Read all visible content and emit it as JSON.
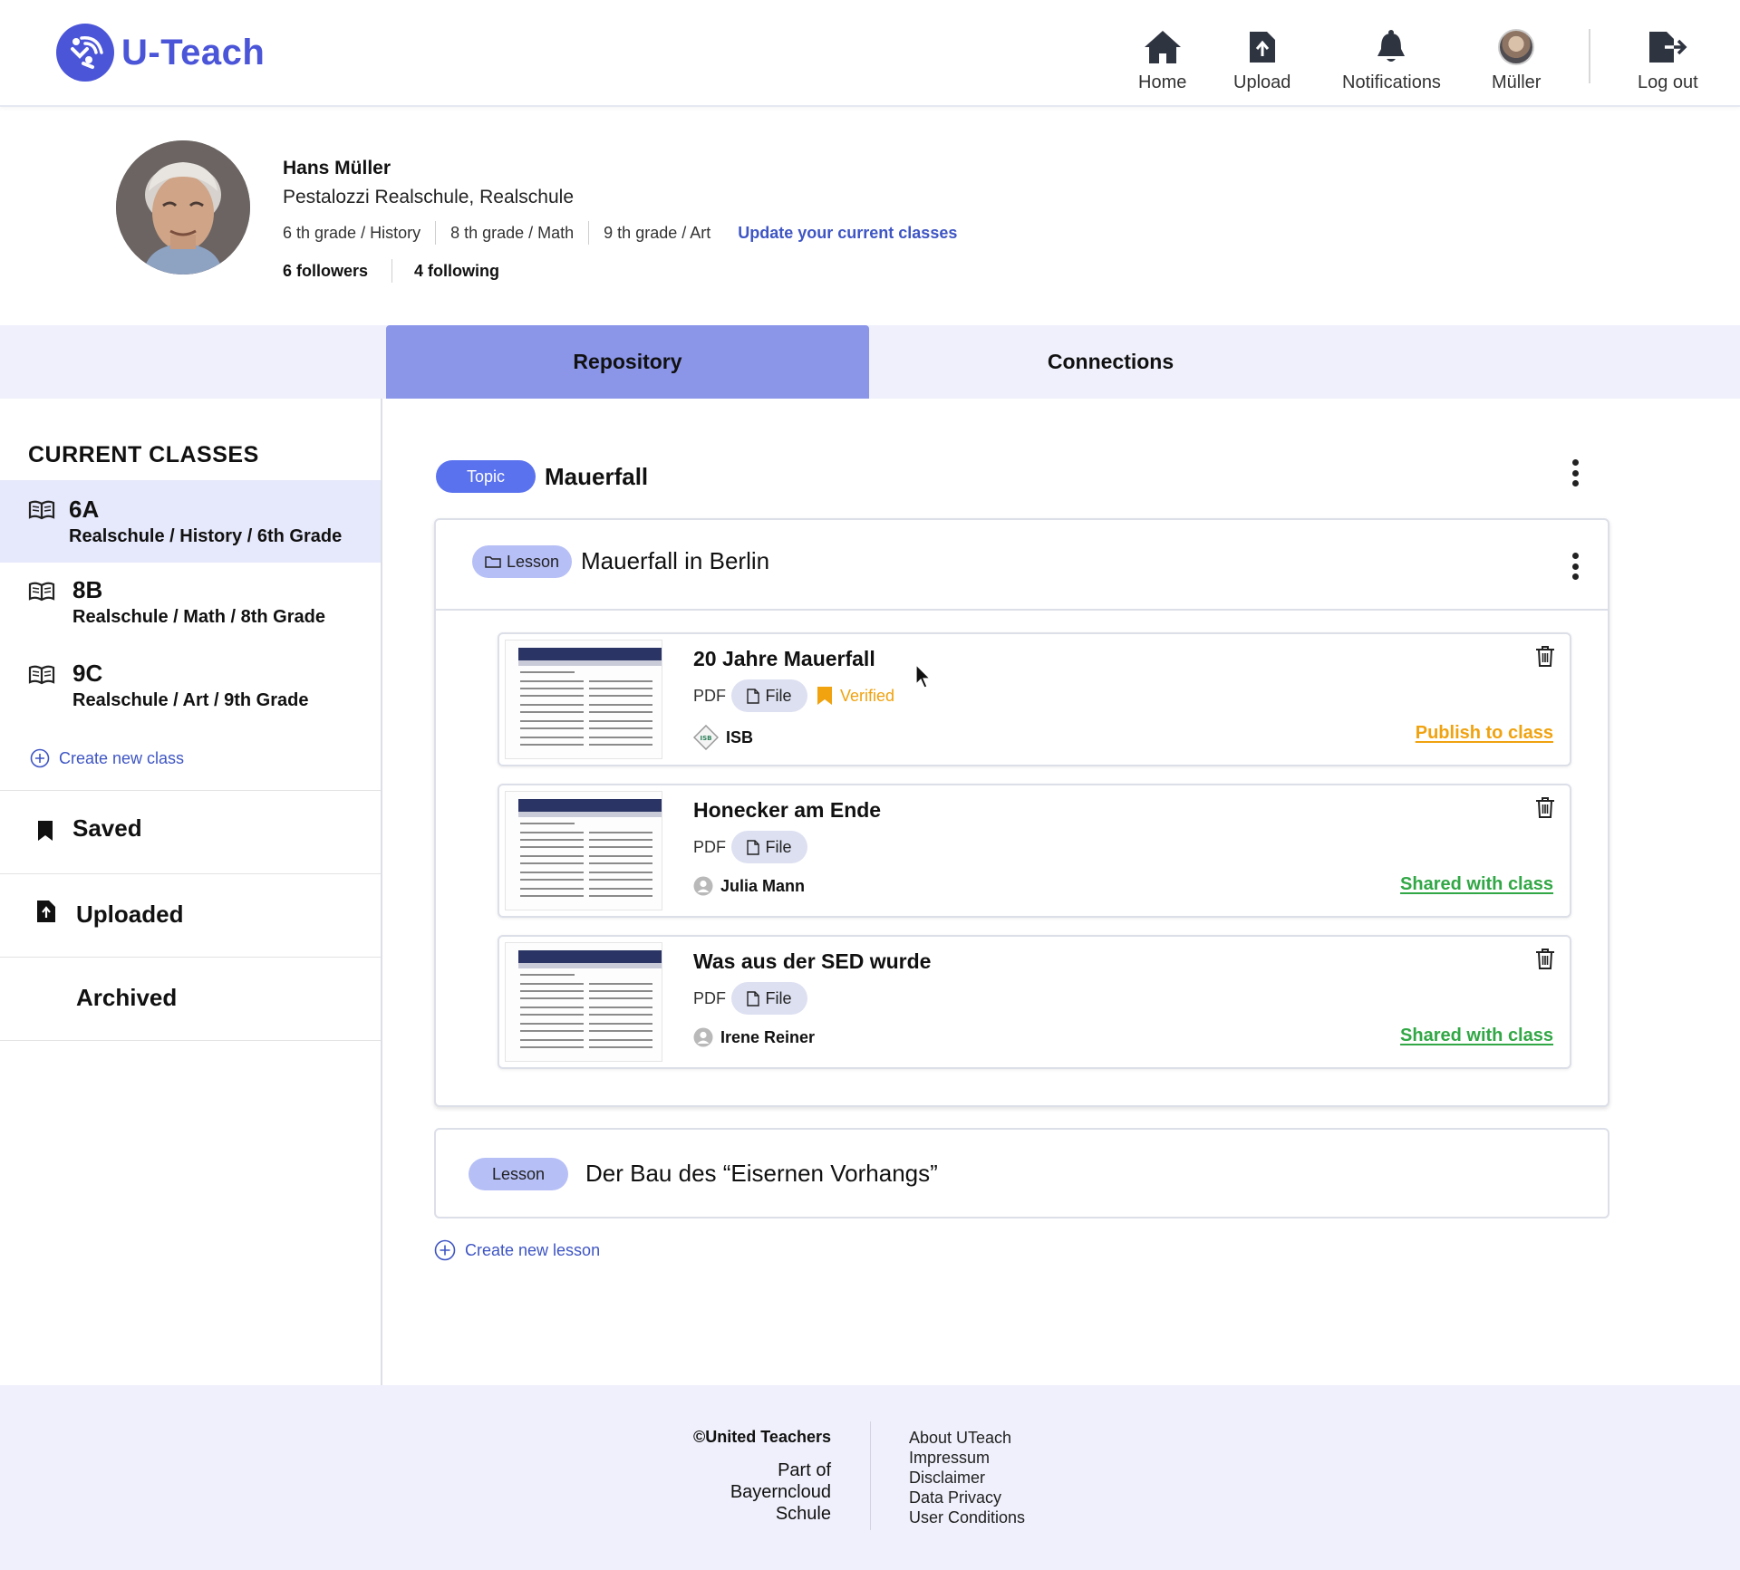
{
  "header": {
    "logo_text": "U-Teach",
    "nav": {
      "home": "Home",
      "upload": "Upload",
      "notifications": "Notifications",
      "user": "Müller",
      "logout": "Log out"
    }
  },
  "profile": {
    "name": "Hans Müller",
    "school": "Pestalozzi Realschule, Realschule",
    "classes": [
      "6 th grade / History",
      "8 th grade / Math",
      "9 th grade / Art"
    ],
    "update_link": "Update your current classes",
    "followers": "6 followers",
    "following": "4 following"
  },
  "tabs": {
    "repository": "Repository",
    "connections": "Connections"
  },
  "sidebar": {
    "title": "CURRENT CLASSES",
    "classes": [
      {
        "name": "6A",
        "desc": "Realschule / History / 6th Grade"
      },
      {
        "name": "8B",
        "desc": "Realschule / Math / 8th Grade"
      },
      {
        "name": "9C",
        "desc": "Realschule / Art / 9th Grade"
      }
    ],
    "create_class": "Create new class",
    "links": {
      "saved": "Saved",
      "uploaded": "Uploaded",
      "archived": "Archived"
    }
  },
  "main": {
    "topic_label": "Topic",
    "topic_title": "Mauerfall",
    "lesson_label": "Lesson",
    "lesson_title": "Mauerfall in Berlin",
    "files": [
      {
        "title": "20 Jahre Mauerfall",
        "type": "PDF",
        "file_label": "File",
        "verified": "Verified",
        "author": "ISB",
        "action": "Publish to class"
      },
      {
        "title": "Honecker am Ende",
        "type": "PDF",
        "file_label": "File",
        "author": "Julia Mann",
        "action": "Shared with class"
      },
      {
        "title": "Was aus der SED wurde",
        "type": "PDF",
        "file_label": "File",
        "author": "Irene Reiner",
        "action": "Shared with class"
      }
    ],
    "lesson2_label": "Lesson",
    "lesson2_title": "Der Bau des “Eisernen Vorhangs”",
    "create_lesson": "Create new lesson"
  },
  "footer": {
    "copyright": "©United Teachers",
    "part_of": "Part of Bayerncloud Schule",
    "links": [
      "About UTeach",
      "Impressum",
      "Disclaimer",
      "Data Privacy",
      "User Conditions"
    ]
  },
  "colors": {
    "brand": "#4b55d8",
    "tab_active": "#8b96e9",
    "topic_pill": "#5b72ee",
    "lesson_pill": "#b6bff6",
    "link": "#3e55c4",
    "publish": "#f0a20f",
    "shared": "#31a745",
    "verified": "#f0a20f"
  }
}
